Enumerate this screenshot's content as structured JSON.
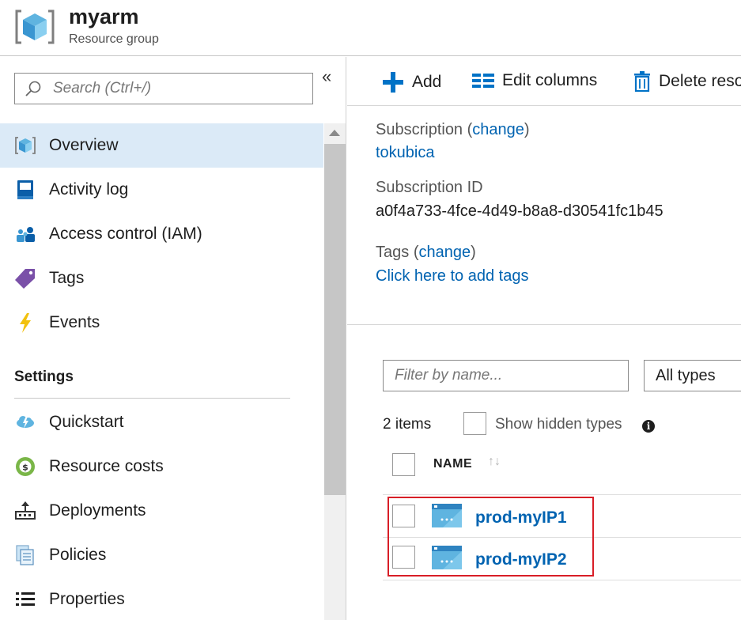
{
  "header": {
    "title": "myarm",
    "subtitle": "Resource group",
    "icon": "resource-group-cube-icon"
  },
  "sidebar": {
    "collapse_glyph": "«",
    "search_placeholder": "Search (Ctrl+/)",
    "items": [
      {
        "label": "Overview",
        "icon": "cube-icon",
        "active": true
      },
      {
        "label": "Activity log",
        "icon": "log-book-icon"
      },
      {
        "label": "Access control (IAM)",
        "icon": "users-icon"
      },
      {
        "label": "Tags",
        "icon": "tag-icon"
      },
      {
        "label": "Events",
        "icon": "lightning-icon"
      }
    ],
    "settings_heading": "Settings",
    "settings_items": [
      {
        "label": "Quickstart",
        "icon": "cloud-lightning-icon"
      },
      {
        "label": "Resource costs",
        "icon": "coin-icon"
      },
      {
        "label": "Deployments",
        "icon": "deployments-icon"
      },
      {
        "label": "Policies",
        "icon": "policies-icon"
      },
      {
        "label": "Properties",
        "icon": "list-icon"
      }
    ]
  },
  "toolbar": {
    "add": "Add",
    "edit_columns": "Edit columns",
    "delete": "Delete reso"
  },
  "essentials": {
    "subscription_label": "Subscription",
    "change": "change",
    "subscription_value": "tokubica",
    "subscription_id_label": "Subscription ID",
    "subscription_id_value": "a0f4a733-4fce-4d49-b8a8-d30541fc1b45",
    "tags_label": "Tags",
    "add_tags": "Click here to add tags"
  },
  "resources": {
    "filter_placeholder": "Filter by name...",
    "types_value": "All types",
    "count": "2 items",
    "show_hidden": "Show hidden types",
    "column_name": "NAME",
    "rows": [
      {
        "name": "prod-myIP1",
        "icon": "public-ip-icon"
      },
      {
        "name": "prod-myIP2",
        "icon": "public-ip-icon"
      }
    ]
  },
  "colors": {
    "link": "#0063b1",
    "active_bg": "#dbeaf7",
    "highlight": "#d81e27",
    "add_blue": "#0072c6"
  }
}
